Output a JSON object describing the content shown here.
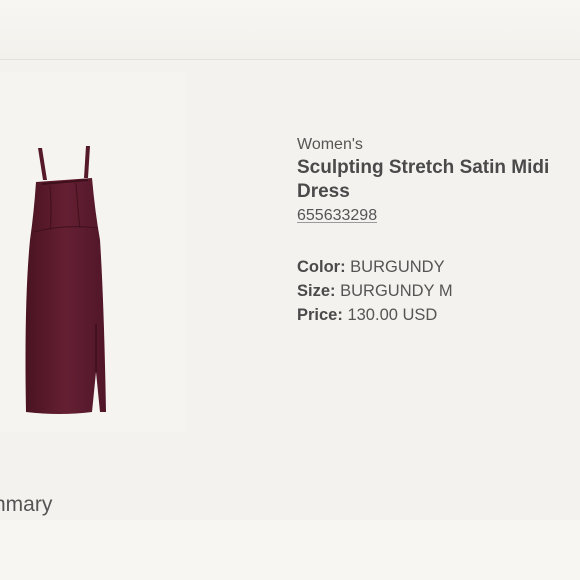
{
  "product": {
    "gender": "Women's",
    "title": "Sculpting Stretch Satin Midi Dress",
    "sku": "655633298",
    "image_alt": "burgundy midi dress",
    "color": "#5a1b2c"
  },
  "attributes": {
    "color_label": "Color:",
    "color_value": "BURGUNDY",
    "size_label": "Size:",
    "size_value": "BURGUNDY M",
    "price_label": "Price:",
    "price_value": "130.00 USD"
  },
  "section": {
    "summary_heading": "nmary"
  }
}
